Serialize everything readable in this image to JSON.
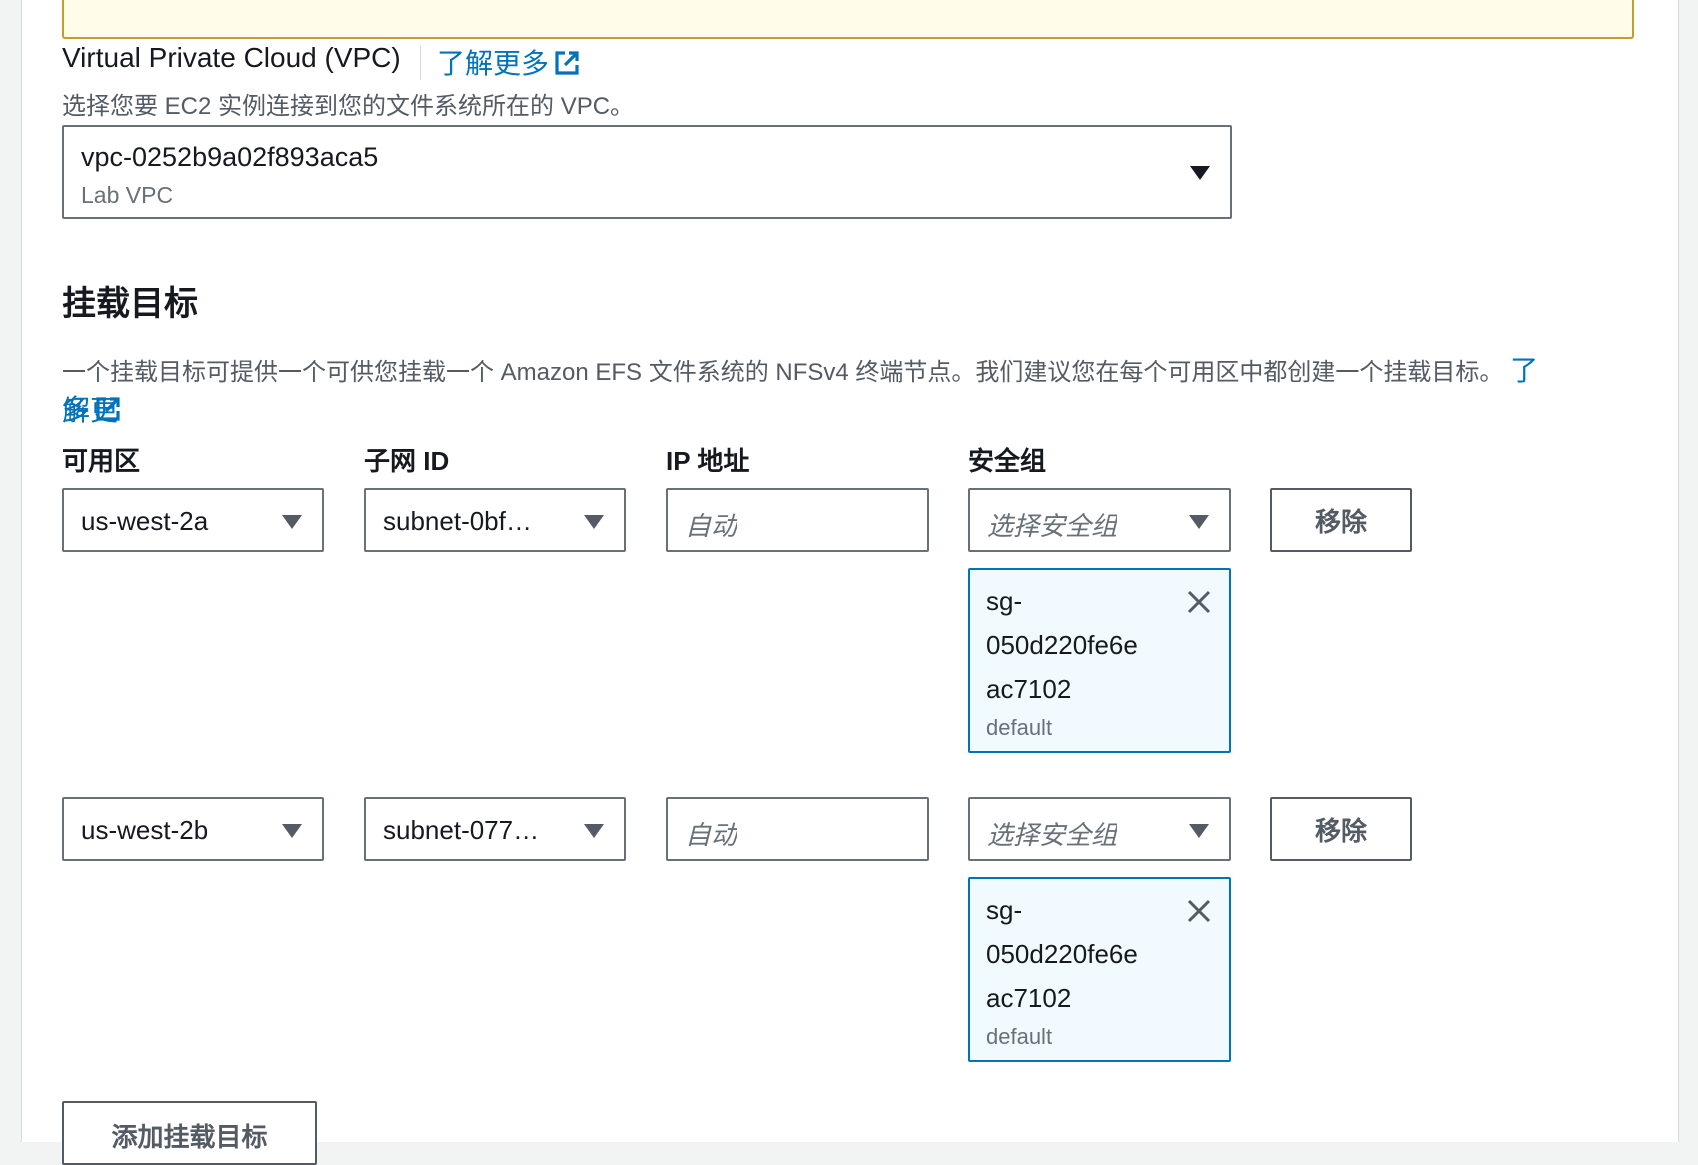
{
  "vpc": {
    "label": "Virtual Private Cloud (VPC)",
    "learn_more": "了解更多",
    "description": "选择您要 EC2 实例连接到您的文件系统所在的 VPC。",
    "selected_id": "vpc-0252b9a02f893aca5",
    "selected_name": "Lab VPC"
  },
  "mount_targets": {
    "title": "挂载目标",
    "description": "一个挂载目标可提供一个可供您挂载一个 Amazon EFS 文件系统的 NFSv4 终端节点。我们建议您在每个可用区中都创建一个挂载目标。",
    "learn_more_a": "了解更",
    "learn_more_b": "多",
    "columns": {
      "az": "可用区",
      "subnet": "子网 ID",
      "ip": "IP 地址",
      "sg": "安全组"
    },
    "rows": [
      {
        "az": "us-west-2a",
        "subnet": "subnet-0bf…",
        "ip_placeholder": "自动",
        "sg_placeholder": "选择安全组",
        "remove": "移除",
        "sg_token": {
          "line1": "sg-",
          "line2": "050d220fe6e",
          "line3": "ac7102",
          "name": "default"
        }
      },
      {
        "az": "us-west-2b",
        "subnet": "subnet-077…",
        "ip_placeholder": "自动",
        "sg_placeholder": "选择安全组",
        "remove": "移除",
        "sg_token": {
          "line1": "sg-",
          "line2": "050d220fe6e",
          "line3": "ac7102",
          "name": "default"
        }
      }
    ],
    "add_button": "添加挂载目标"
  },
  "icons": {
    "external_link": "external-link-icon",
    "caret": "caret-down-icon",
    "remove_token": "close-icon"
  },
  "colors": {
    "link": "#0073bb",
    "warning_border": "#c59c2f",
    "token_bg": "#f1faff"
  }
}
